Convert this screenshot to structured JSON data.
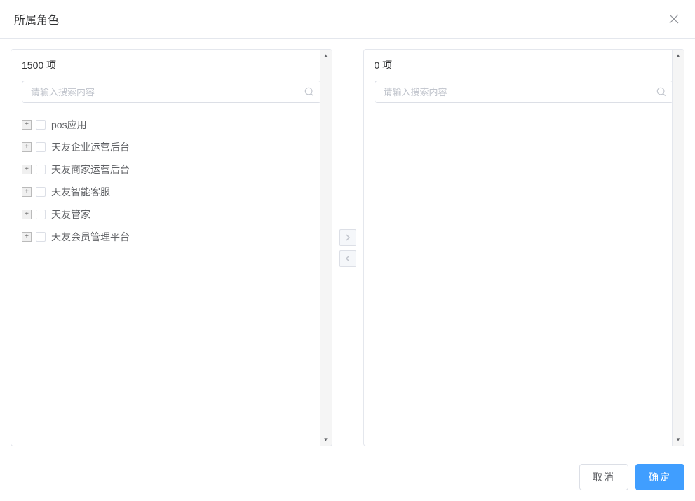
{
  "dialog": {
    "title": "所属角色"
  },
  "source": {
    "count_label": "1500 项",
    "search_placeholder": "请输入搜索内容",
    "items": [
      {
        "label": "pos应用"
      },
      {
        "label": "天友企业运营后台"
      },
      {
        "label": "天友商家运营后台"
      },
      {
        "label": "天友智能客服"
      },
      {
        "label": "天友管家"
      },
      {
        "label": "天友会员管理平台"
      }
    ]
  },
  "target": {
    "count_label": "0 项",
    "search_placeholder": "请输入搜索内容"
  },
  "footer": {
    "cancel": "取消",
    "confirm": "确定"
  }
}
